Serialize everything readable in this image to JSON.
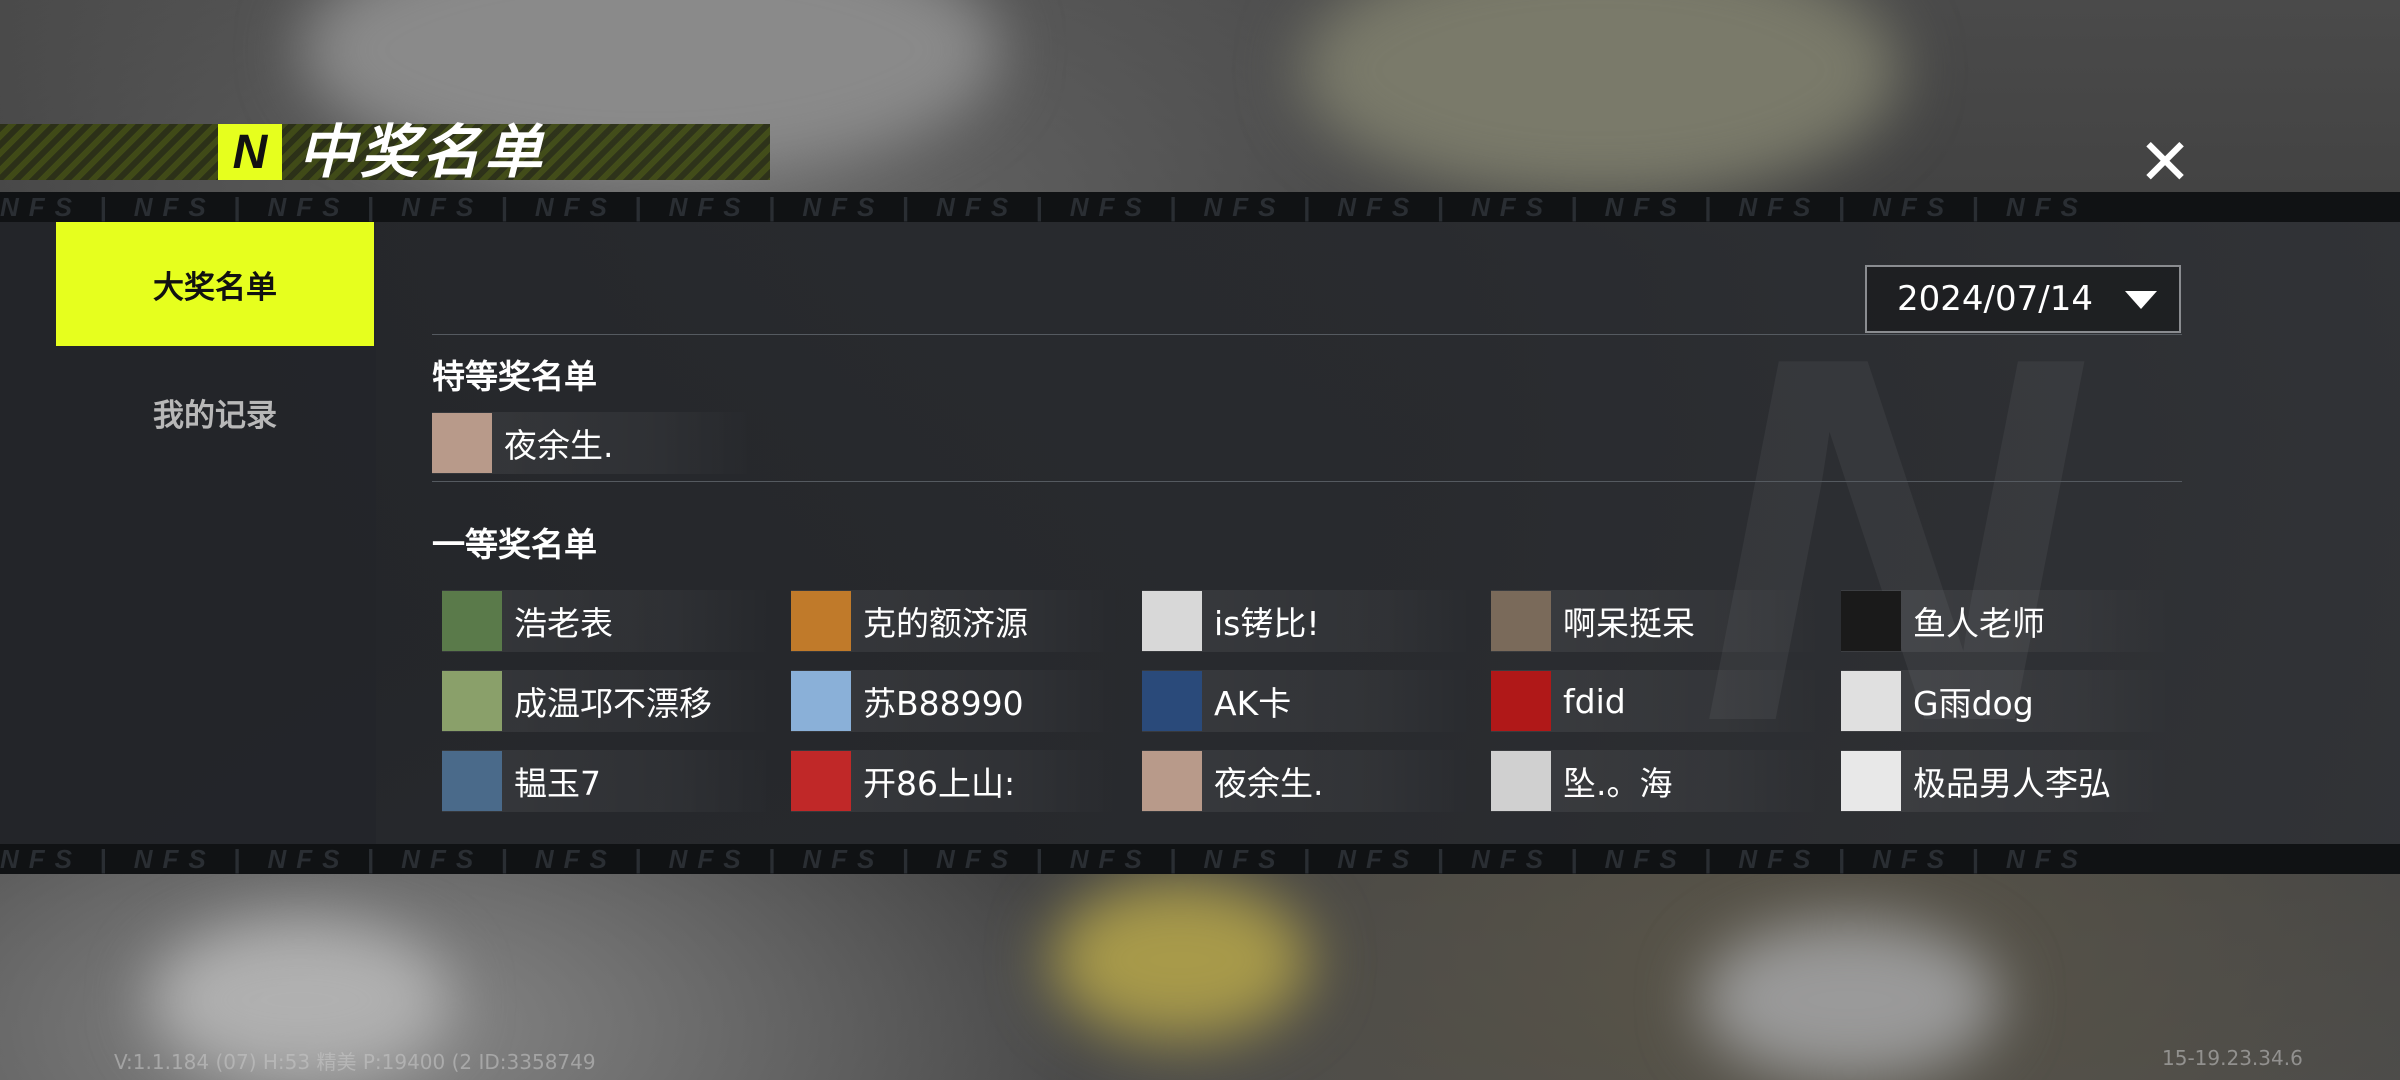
{
  "header": {
    "logo_letter": "N",
    "title": "中奖名单",
    "close_icon": "close-icon"
  },
  "band": {
    "text": "NFS | NFS | NFS | NFS | NFS | NFS | NFS | NFS | NFS | NFS | NFS | NFS | NFS | NFS | NFS | NFS"
  },
  "sidebar": {
    "items": [
      {
        "label": "大奖名单",
        "active": true
      },
      {
        "label": "我的记录",
        "active": false
      }
    ]
  },
  "date_select": {
    "value": "2024/07/14",
    "icon": "caret-down-icon"
  },
  "special": {
    "title": "特等奖名单",
    "winners": [
      {
        "name": "夜余生.",
        "avatar_color": "#b89a8a"
      }
    ]
  },
  "first": {
    "title": "一等奖名单",
    "winners": [
      {
        "name": "浩老表",
        "avatar_color": "#5a7a4a"
      },
      {
        "name": "克的额济源",
        "avatar_color": "#c07a2a"
      },
      {
        "name": "is铐比!",
        "avatar_color": "#d8d8d8"
      },
      {
        "name": "啊呆挺呆",
        "avatar_color": "#7a6a5a"
      },
      {
        "name": "鱼人老师",
        "avatar_color": "#1a1a1a"
      },
      {
        "name": "成温邛不漂移",
        "avatar_color": "#8aa06a"
      },
      {
        "name": "苏B88990",
        "avatar_color": "#8ab0d8"
      },
      {
        "name": "AK卡",
        "avatar_color": "#2a4a7a"
      },
      {
        "name": "fdid",
        "avatar_color": "#b01818"
      },
      {
        "name": "G雨dog",
        "avatar_color": "#e0e0e0"
      },
      {
        "name": "韫玉7",
        "avatar_color": "#4a6a8a"
      },
      {
        "name": "开86上山:",
        "avatar_color": "#c02828"
      },
      {
        "name": "夜余生.",
        "avatar_color": "#b89a8a"
      },
      {
        "name": "坠.。海",
        "avatar_color": "#d0d0d0"
      },
      {
        "name": "极品男人李弘",
        "avatar_color": "#e8e8e8"
      }
    ]
  },
  "footer": {
    "left": "V:1.1.184 (07) H:53 精美 P:19400 (2 ID:3358749",
    "right": "15-19.23.34.6"
  }
}
